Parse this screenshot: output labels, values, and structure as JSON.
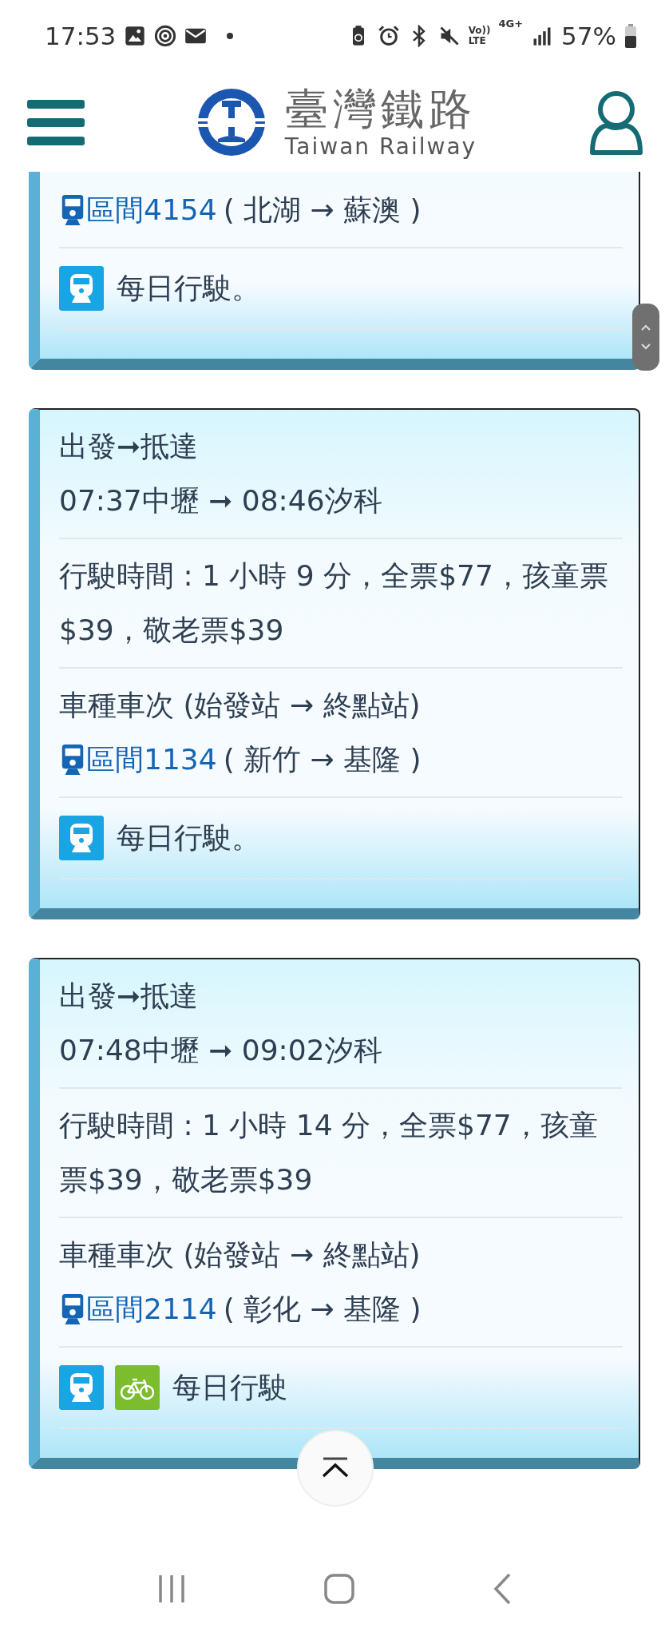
{
  "status_bar": {
    "time": "17:53",
    "volte_top": "Vo))",
    "volte_bottom": "LTE",
    "network": "4G+",
    "battery": "57%"
  },
  "header": {
    "title": "臺灣鐵路",
    "subtitle": "Taiwan Railway"
  },
  "trips": [
    {
      "partial": true,
      "train_type": "區間4154",
      "route": "( 北湖 → 蘇澳 )",
      "services": [
        {
          "kind": "train"
        }
      ],
      "note": "每日行駛。"
    },
    {
      "partial": false,
      "heading": "出發➞抵達",
      "times": "07:37中壢 ➞ 08:46汐科",
      "fare": "行駛時間 : 1 小時 9 分，全票$77，孩童票$39，敬老票$39",
      "train_heading": "車種車次 (始發站 → 終點站)",
      "train_type": "區間1134",
      "route": "( 新竹 → 基隆 )",
      "services": [
        {
          "kind": "train"
        }
      ],
      "note": "每日行駛。"
    },
    {
      "partial": false,
      "heading": "出發➞抵達",
      "times": "07:48中壢 ➞ 09:02汐科",
      "fare": "行駛時間 : 1 小時 14 分，全票$77，孩童票$39，敬老票$39",
      "train_heading": "車種車次 (始發站 → 終點站)",
      "train_type": "區間2114",
      "route": "( 彰化 → 基隆 )",
      "services": [
        {
          "kind": "train"
        },
        {
          "kind": "bike"
        }
      ],
      "note": "每日行駛"
    }
  ]
}
